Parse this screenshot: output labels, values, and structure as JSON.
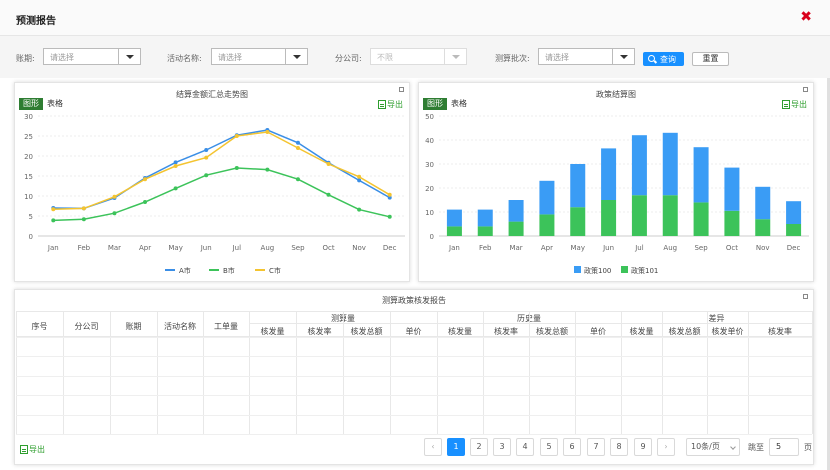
{
  "modal": {
    "title": "预测报告"
  },
  "filters": {
    "period_label": "账期:",
    "period_placeholder": "请选择",
    "activity_label": "活动名称:",
    "activity_placeholder": "请选择",
    "branch_label": "分公司:",
    "branch_placeholder": "不限",
    "batch_label": "测算批次:",
    "batch_placeholder": "请选择",
    "query_label": "查询",
    "reset_label": "重置"
  },
  "line_panel": {
    "title": "结算金额汇总走势图",
    "tab_chart": "图形",
    "tab_table": "表格",
    "export": "导出"
  },
  "bar_panel": {
    "title": "政策结算图",
    "tab_chart": "图形",
    "tab_table": "表格",
    "export": "导出"
  },
  "chart_data": [
    {
      "type": "line",
      "title": "结算金额汇总走势图",
      "categories": [
        "Jan",
        "Feb",
        "Mar",
        "Apr",
        "May",
        "Jun",
        "Jul",
        "Aug",
        "Sep",
        "Oct",
        "Nov",
        "Dec"
      ],
      "ylim": [
        0,
        30
      ],
      "yticks": [
        0,
        5,
        10,
        15,
        20,
        25,
        30
      ],
      "grid": true,
      "legend": "bottom",
      "series": [
        {
          "name": "A市",
          "color": "#3a8ee6",
          "values": [
            7.0,
            6.9,
            9.5,
            14.5,
            18.4,
            21.5,
            25.2,
            26.5,
            23.3,
            18.3,
            13.9,
            9.6
          ]
        },
        {
          "name": "B市",
          "color": "#3cc35a",
          "values": [
            3.9,
            4.2,
            5.7,
            8.5,
            11.9,
            15.2,
            17.0,
            16.6,
            14.2,
            10.3,
            6.6,
            4.8
          ]
        },
        {
          "name": "C市",
          "color": "#f4c430",
          "values": [
            6.7,
            6.9,
            9.8,
            14.2,
            17.5,
            19.6,
            25.0,
            26.0,
            22.0,
            18.0,
            14.8,
            10.3
          ]
        }
      ]
    },
    {
      "type": "bar",
      "title": "政策结算图",
      "stacked": true,
      "categories": [
        "Jan",
        "Feb",
        "Mar",
        "Apr",
        "May",
        "Jun",
        "Jul",
        "Aug",
        "Sep",
        "Oct",
        "Nov",
        "Dec"
      ],
      "ylim": [
        0,
        50
      ],
      "yticks": [
        0,
        10,
        20,
        30,
        40,
        50
      ],
      "grid": true,
      "legend": "bottom",
      "series": [
        {
          "name": "政策101",
          "color": "#3cc35a",
          "values": [
            4,
            4,
            6,
            9,
            12,
            15,
            17,
            17,
            14,
            10.5,
            7,
            5
          ]
        },
        {
          "name": "政策100",
          "color": "#3a9cf5",
          "values": [
            7,
            7,
            9,
            14,
            18,
            21.5,
            25,
            26,
            23,
            18,
            13.5,
            9.5
          ]
        }
      ]
    }
  ],
  "table": {
    "title": "测算政策核发报告",
    "col_seq": "序号",
    "col_branch": "分公司",
    "col_period": "账期",
    "col_activity": "活动名称",
    "col_orders": "工单量",
    "grp_calc": "测算量",
    "grp_hist": "历史量",
    "grp_diff": "差异",
    "calc_cols": [
      "核发量",
      "核发率",
      "核发总额",
      "单价"
    ],
    "hist_cols": [
      "核发量",
      "核发率",
      "核发总额",
      "单价"
    ],
    "diff_cols": [
      "核发量",
      "核发总额",
      "核发单价",
      "核发率"
    ],
    "export": "导出"
  },
  "pagination": {
    "pages": [
      "1",
      "2",
      "3",
      "4",
      "5",
      "6",
      "7",
      "8",
      "9"
    ],
    "prev": "‹",
    "next": "›",
    "page_size": "10条/页",
    "jump_label": "跳至",
    "jump_value": "5",
    "page_unit": "页"
  }
}
